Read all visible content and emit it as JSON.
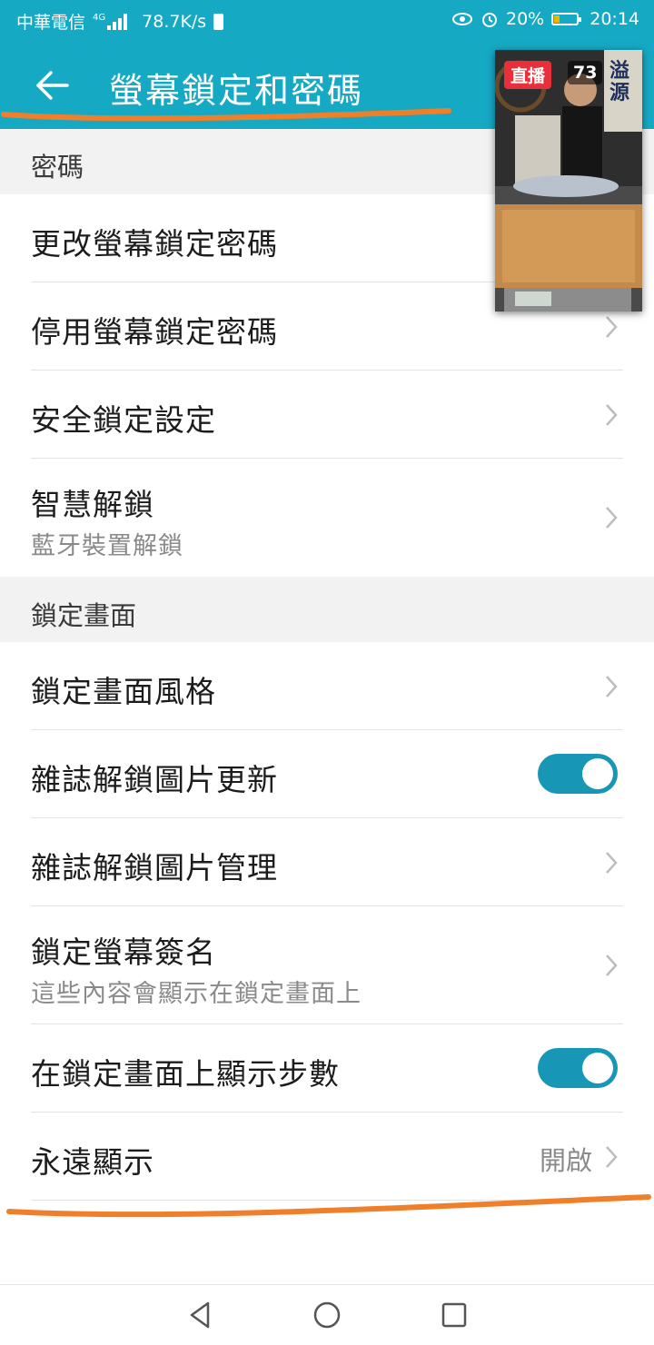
{
  "status_bar": {
    "carrier": "中華電信",
    "network": "4G",
    "speed": "78.7K/s",
    "battery": "20%",
    "time": "20:14",
    "icons": [
      "signal-icon",
      "sim-icon",
      "eye-icon",
      "alarm-icon",
      "battery-icon"
    ]
  },
  "app_bar": {
    "title": "螢幕鎖定和密碼",
    "back_icon": "back-arrow-icon"
  },
  "sections": [
    {
      "header": "密碼",
      "items": [
        {
          "title": "更改螢幕鎖定密碼",
          "control": "chevron"
        },
        {
          "title": "停用螢幕鎖定密碼",
          "control": "chevron"
        },
        {
          "title": "安全鎖定設定",
          "control": "chevron"
        },
        {
          "title": "智慧解鎖",
          "subtitle": "藍牙裝置解鎖",
          "control": "chevron"
        }
      ]
    },
    {
      "header": "鎖定畫面",
      "items": [
        {
          "title": "鎖定畫面風格",
          "control": "chevron"
        },
        {
          "title": "雜誌解鎖圖片更新",
          "control": "toggle",
          "enabled": true
        },
        {
          "title": "雜誌解鎖圖片管理",
          "control": "chevron"
        },
        {
          "title": "鎖定螢幕簽名",
          "subtitle": "這些內容會顯示在鎖定畫面上",
          "control": "chevron"
        },
        {
          "title": "在鎖定畫面上顯示步數",
          "control": "toggle",
          "enabled": true
        },
        {
          "title": "永遠顯示",
          "value": "開啟",
          "control": "chevron"
        }
      ]
    }
  ],
  "pip_overlay": {
    "live_label": "直播",
    "viewer_count": "73",
    "sign_text": "溢源"
  },
  "nav_bar": {
    "icons": [
      "nav-back-icon",
      "nav-home-icon",
      "nav-recents-icon"
    ]
  },
  "colors": {
    "accent": "#16a9c4",
    "toggle_on": "#1896b5",
    "annotation": "#f07f2a",
    "live_red": "#e8303c"
  }
}
